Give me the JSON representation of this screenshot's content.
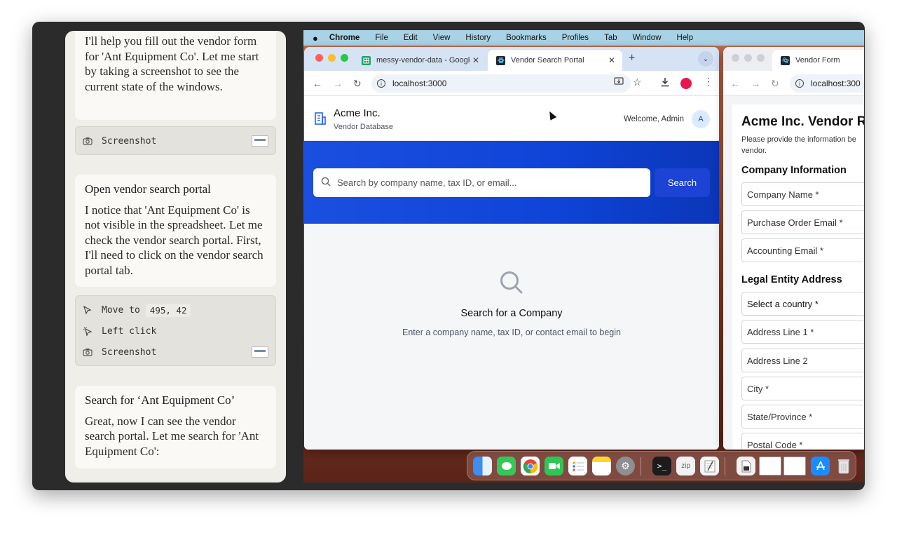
{
  "chat": {
    "messages": [
      {
        "title": "",
        "body": "I'll help you fill out the vendor form for 'Ant Equipment Co'. Let me start by taking a screenshot to see the current state of the windows."
      },
      {
        "title": "Open vendor search portal",
        "body": "I notice that 'Ant Equipment Co' is not visible in the spreadsheet. Let me check the vendor search portal. First, I'll need to click on the vendor search portal tab."
      },
      {
        "title": "Search for ‘Ant Equipment Co’",
        "body": "Great, now I can see the vendor search portal. Let me search for 'Ant Equipment Co':"
      }
    ],
    "tool_group_1": {
      "screenshot_label": "Screenshot"
    },
    "tool_group_2": {
      "move_label": "Move to",
      "move_coord": "495, 42",
      "click_label": "Left click",
      "screenshot_label": "Screenshot"
    }
  },
  "menubar": {
    "app": "Chrome",
    "items": [
      "File",
      "Edit",
      "View",
      "History",
      "Bookmarks",
      "Profiles",
      "Tab",
      "Window",
      "Help"
    ]
  },
  "browser": {
    "tabs": [
      {
        "label": "messy-vendor-data - Google"
      },
      {
        "label": "Vendor Search Portal"
      }
    ],
    "url": "localhost:3000"
  },
  "portal": {
    "company": "Acme Inc.",
    "subtitle": "Vendor Database",
    "welcome": "Welcome, Admin",
    "avatar": "A",
    "search_placeholder": "Search by company name, tax ID, or email...",
    "search_button": "Search",
    "empty_title": "Search for a Company",
    "empty_text": "Enter a company name, tax ID, or contact email to begin"
  },
  "form_window": {
    "tab": "Vendor Form",
    "url": "localhost:300",
    "title": "Acme Inc. Vendor R",
    "intro": "Please provide the information be vendor.",
    "section_company": "Company Information",
    "fields_company": [
      "Company Name *",
      "Purchase Order Email *",
      "Accounting Email *"
    ],
    "section_address": "Legal Entity Address",
    "country_select": "Select a country *",
    "fields_address": [
      "Address Line 1 *",
      "Address Line 2",
      "City *",
      "State/Province *",
      "Postal Code *"
    ]
  },
  "colors": {
    "hero_blue": "#1a4fe0",
    "search_button": "#1c43d3",
    "menubar": "#a9d2e6"
  }
}
